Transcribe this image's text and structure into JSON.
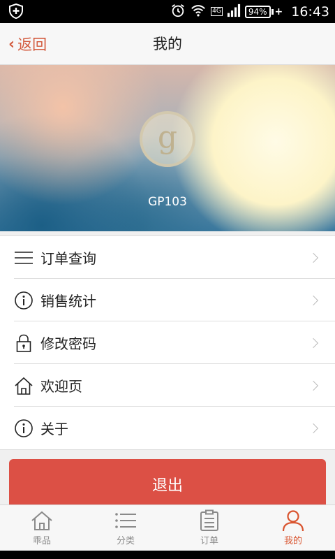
{
  "status_bar": {
    "time": "16:43",
    "battery": "94%",
    "network": "4G",
    "icons": [
      "shield-icon",
      "alarm-icon",
      "wifi-icon",
      "signal-icon",
      "battery-icon"
    ]
  },
  "nav": {
    "back_label": "返回",
    "title": "我的"
  },
  "profile": {
    "logo_letter": "g",
    "username": "GP103"
  },
  "menu": {
    "items": [
      {
        "label": "订单查询",
        "icon": "list-icon"
      },
      {
        "label": "销售统计",
        "icon": "info-icon"
      },
      {
        "label": "修改密码",
        "icon": "lock-icon"
      },
      {
        "label": "欢迎页",
        "icon": "home-icon"
      },
      {
        "label": "关于",
        "icon": "info-icon"
      }
    ]
  },
  "logout_label": "退出",
  "tabs": [
    {
      "label": "乖品",
      "icon": "home-icon",
      "active": false
    },
    {
      "label": "分类",
      "icon": "category-list-icon",
      "active": false
    },
    {
      "label": "订单",
      "icon": "clipboard-icon",
      "active": false
    },
    {
      "label": "我的",
      "icon": "user-icon",
      "active": true
    }
  ],
  "colors": {
    "accent": "#d9542f",
    "logout_button": "#dc5045"
  }
}
